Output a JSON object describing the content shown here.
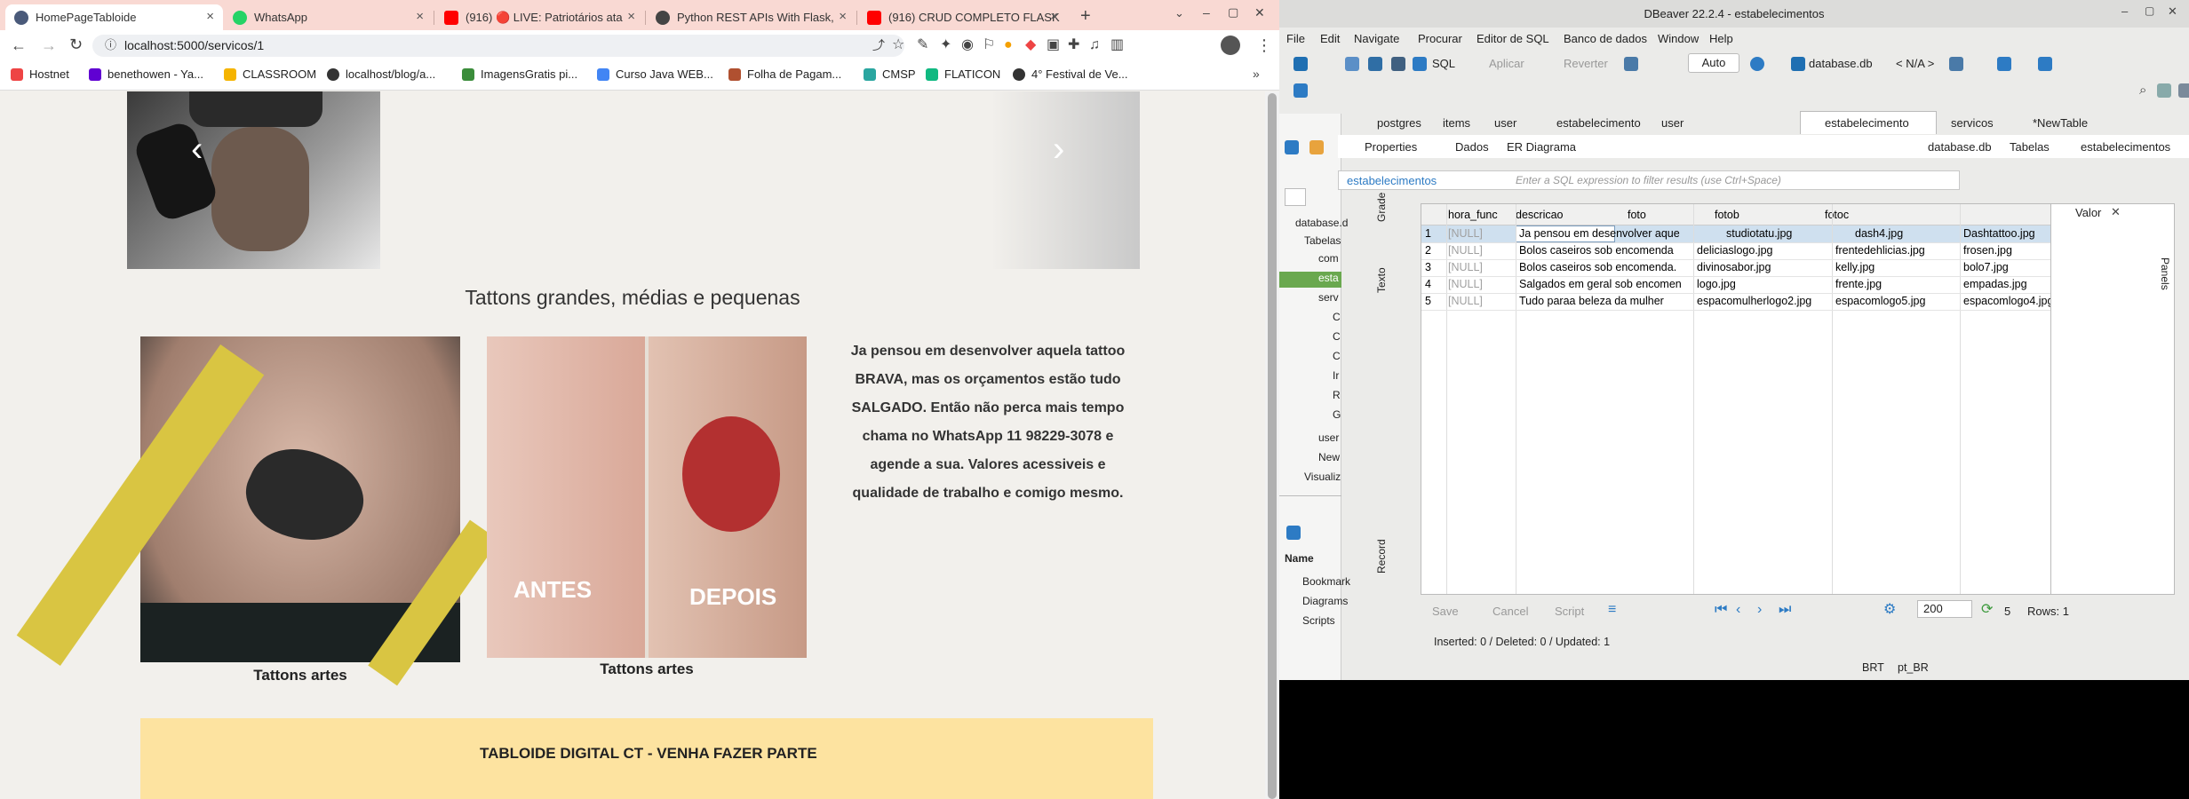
{
  "browser": {
    "tabs": [
      {
        "label": "HomePageTabloide",
        "icon": "globe-icon",
        "color": "#4a5a7a"
      },
      {
        "label": "WhatsApp",
        "icon": "whatsapp-icon",
        "color": "#25d366"
      },
      {
        "label": "(916) 🔴 LIVE: Patriotários ata",
        "icon": "youtube-icon",
        "color": "#ff0000"
      },
      {
        "label": "Python REST APIs With Flask,",
        "icon": "globe-icon",
        "color": "#444"
      },
      {
        "label": "(916) CRUD COMPLETO FLASK",
        "icon": "youtube-icon",
        "color": "#ff0000"
      }
    ],
    "address": "localhost:5000/servicos/1",
    "bookmarks": [
      {
        "label": "Hostnet",
        "color": "#e44"
      },
      {
        "label": "benethowen - Ya...",
        "color": "#6001d2"
      },
      {
        "label": "CLASSROOM",
        "color": "#f5b400"
      },
      {
        "label": "localhost/blog/a...",
        "color": "#333"
      },
      {
        "label": "ImagensGratis pi...",
        "color": "#3b8d3b"
      },
      {
        "label": "Curso Java WEB...",
        "color": "#4285f4"
      },
      {
        "label": "Folha de Pagam...",
        "color": "#b05030"
      },
      {
        "label": "CMSP",
        "color": "#2aa6a0"
      },
      {
        "label": "FLATICON",
        "color": "#10b981"
      },
      {
        "label": "4° Festival de Ve...",
        "color": "#333"
      }
    ]
  },
  "page": {
    "heading": "Tattons grandes, médias e pequenas",
    "description": "Ja pensou em desenvolver aquela tattoo BRAVA, mas os orçamentos estão tudo SALGADO. Então não perca mais tempo chama no WhatsApp 11 98229-3078 e agende a sua. Valores acessiveis e qualidade de trabalho e comigo mesmo.",
    "caption1": "Tattons artes",
    "caption2": "Tattons artes",
    "img2_before": "ANTES",
    "img2_after": "DEPOIS",
    "banner": "TABLOIDE DIGITAL CT - VENHA FAZER PARTE"
  },
  "dbeaver": {
    "title": "DBeaver 22.2.4 - estabelecimentos",
    "menu": [
      "File",
      "Edit",
      "Navigate",
      "Procurar",
      "Editor de SQL",
      "Banco de dados",
      "Window",
      "Help"
    ],
    "toolbar": {
      "sql": "SQL",
      "apply": "Aplicar",
      "revert": "Reverter",
      "auto": "Auto",
      "db": "database.db",
      "na": "< N/A >"
    },
    "editor_tabs": [
      "postgres",
      "items",
      "user",
      "estabelecimento",
      "user",
      "estabelecimento",
      "servicos",
      "*NewTable"
    ],
    "sub_tabs": [
      "Properties",
      "Dados",
      "ER Diagrama"
    ],
    "crumbs": [
      "database.db",
      "Tabelas",
      "estabelecimentos"
    ],
    "filter_table": "estabelecimentos",
    "filter_placeholder": "Enter a SQL expression to filter results (use Ctrl+Space)",
    "side_labels": {
      "grid": "Grade",
      "text": "Texto",
      "record": "Record"
    },
    "value_panel": "Valor",
    "panels_label": "Panels",
    "tree": [
      "database.d",
      "Tabelas",
      "com",
      "esta",
      "serv",
      "C",
      "C",
      "C",
      "Ir",
      "R",
      "G",
      "user",
      "New",
      "Visualiz"
    ],
    "name_label": "Name",
    "projects": [
      "Bookmark",
      "Diagrams",
      "Scripts"
    ],
    "columns": [
      "hora_func",
      "descricao",
      "foto",
      "fotob",
      "fotoc"
    ],
    "rows": [
      [
        "1",
        "[NULL]",
        "Ja pensou em desenvolver aque",
        "studiotatu.jpg",
        "dash4.jpg",
        "Dashtattoo.jpg"
      ],
      [
        "2",
        "[NULL]",
        "Bolos caseiros sob encomenda",
        "deliciaslogo.jpg",
        "frentedehlicias.jpg",
        "frosen.jpg"
      ],
      [
        "3",
        "[NULL]",
        "Bolos caseiros sob encomenda.",
        "divinosabor.jpg",
        "kelly.jpg",
        "bolo7.jpg"
      ],
      [
        "4",
        "[NULL]",
        "Salgados em geral sob encomen",
        "logo.jpg",
        "frente.jpg",
        "empadas.jpg"
      ],
      [
        "5",
        "[NULL]",
        "Tudo paraa beleza da mulher",
        "espacomulherlogo2.jpg",
        "espacomlogo5.jpg",
        "espacomlogo4.jpg"
      ]
    ],
    "bottom": {
      "save": "Save",
      "cancel": "Cancel",
      "script": "Script",
      "limit": "200",
      "count": "5",
      "rows": "Rows: 1"
    },
    "status": "Inserted: 0 / Deleted: 0 / Updated: 1",
    "tz": "BRT",
    "locale": "pt_BR"
  }
}
